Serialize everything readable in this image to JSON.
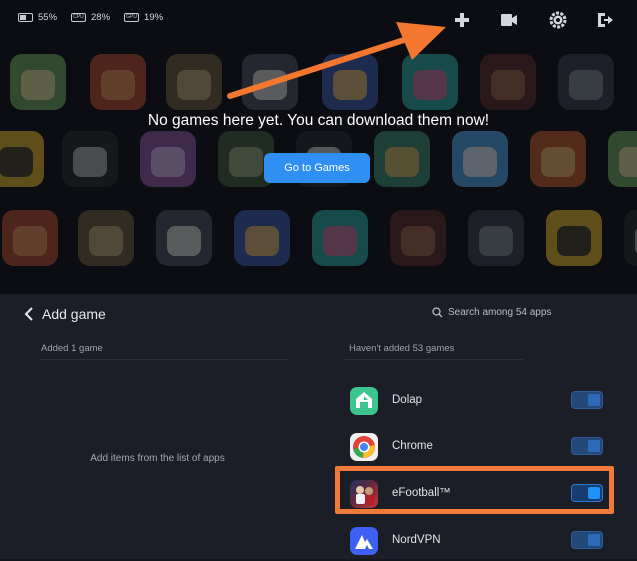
{
  "status": {
    "battery": {
      "icon": "battery-icon",
      "value": "55%"
    },
    "cpu": {
      "icon": "cpu-icon",
      "label": "CPU",
      "value": "28%"
    },
    "gpu": {
      "icon": "gpu-icon",
      "label": "GPU",
      "value": "19%"
    }
  },
  "top_actions": [
    {
      "name": "add-game-icon",
      "icon": "plus"
    },
    {
      "name": "record-icon",
      "icon": "video-camera"
    },
    {
      "name": "settings-icon",
      "icon": "gear"
    },
    {
      "name": "exit-icon",
      "icon": "exit"
    }
  ],
  "library": {
    "empty_message": "No games here yet. You can download them now!",
    "go_button": "Go to Games"
  },
  "panel": {
    "title": "Add game",
    "search_placeholder": "Search among 54 apps",
    "added_header": "Added 1 game",
    "not_added_header": "Haven't added 53 games",
    "empty_hint": "Add items from the list of apps",
    "apps": [
      {
        "name": "Dolap",
        "enabled": false
      },
      {
        "name": "Chrome",
        "enabled": false
      },
      {
        "name": "eFootball™",
        "enabled": true
      },
      {
        "name": "NordVPN",
        "enabled": false
      }
    ]
  },
  "colors": {
    "accent": "#2f8ff2",
    "highlight": "#f07a3a",
    "panel_bg": "#1b1e26"
  }
}
